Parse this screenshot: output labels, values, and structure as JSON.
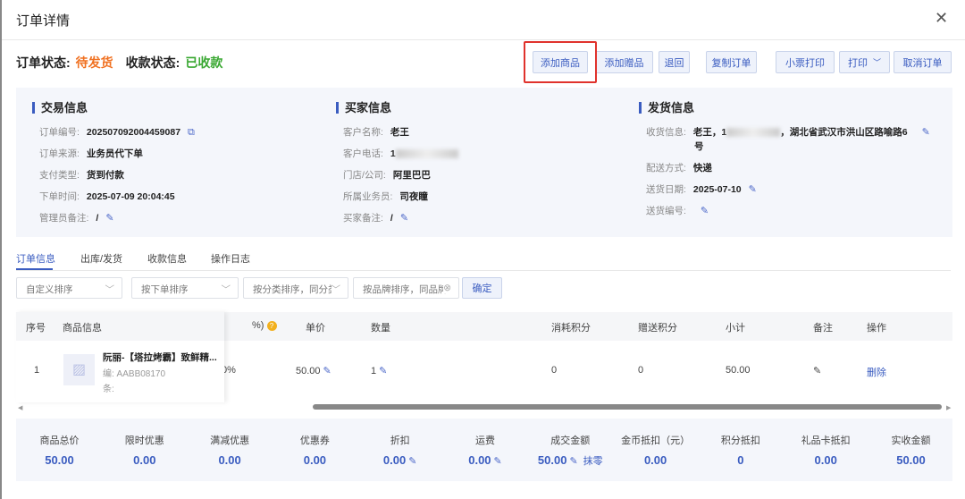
{
  "dialog": {
    "title": "订单详情"
  },
  "status": {
    "order_label": "订单状态:",
    "order_value": "待发货",
    "pay_label": "收款状态:",
    "pay_value": "已收款"
  },
  "actions": [
    "添加商品",
    "添加赠品",
    "退回",
    "复制订单",
    "小票打印",
    "打印",
    "取消订单"
  ],
  "trade": {
    "title": "交易信息",
    "rows": [
      {
        "k": "订单编号:",
        "v": "202507092004459087"
      },
      {
        "k": "订单来源:",
        "v": "业务员代下单"
      },
      {
        "k": "支付类型:",
        "v": "货到付款"
      },
      {
        "k": "下单时间:",
        "v": "2025-07-09 20:04:45"
      },
      {
        "k": "管理员备注:",
        "v": "/"
      }
    ]
  },
  "buyer": {
    "title": "买家信息",
    "rows": [
      {
        "k": "客户名称:",
        "v": "老王"
      },
      {
        "k": "客户电话:",
        "v": "1"
      },
      {
        "k": "门店/公司:",
        "v": "阿里巴巴"
      },
      {
        "k": "所属业务员:",
        "v": "司夜瞳"
      },
      {
        "k": "买家备注:",
        "v": "/"
      }
    ]
  },
  "ship": {
    "title": "发货信息",
    "rows": [
      {
        "k": "收货信息:",
        "v": "老王，1",
        "v2": "，湖北省武汉市洪山区路喻路6",
        "v3": "号"
      },
      {
        "k": "配送方式:",
        "v": "快递"
      },
      {
        "k": "送货日期:",
        "v": "2025-07-10"
      },
      {
        "k": "送货编号:",
        "v": ""
      }
    ]
  },
  "tabs": [
    "订单信息",
    "出库/发货",
    "收款信息",
    "操作日志"
  ],
  "filters": [
    "自定义排序",
    "按下单排序",
    "按分类排序，同分类",
    "按品牌排序，同品牌"
  ],
  "confirm": "确定",
  "table": {
    "headers": [
      "序号",
      "商品信息",
      "%)",
      "单价",
      "数量",
      "消耗积分",
      "赠送积分",
      "小计",
      "备注",
      "操作"
    ],
    "row": {
      "index": "1",
      "name": "阮丽-【塔拉烤霸】致鲜精...",
      "code": "编: AABB08170",
      "bar": "条:",
      "discount": "0%",
      "price": "50.00",
      "qty": "1",
      "used_points": "0",
      "given_points": "0",
      "subtotal": "50.00",
      "action": "删除"
    }
  },
  "summary": [
    {
      "k": "商品总价",
      "v": "50.00"
    },
    {
      "k": "限时优惠",
      "v": "0.00"
    },
    {
      "k": "满减优惠",
      "v": "0.00"
    },
    {
      "k": "优惠券",
      "v": "0.00"
    },
    {
      "k": "折扣",
      "v": "0.00"
    },
    {
      "k": "运费",
      "v": "0.00"
    },
    {
      "k": "成交金额",
      "v": "50.00",
      "extra": "抹零"
    },
    {
      "k": "金币抵扣（元）",
      "v": "0.00"
    },
    {
      "k": "积分抵扣",
      "v": "0"
    },
    {
      "k": "礼品卡抵扣",
      "v": "0.00"
    },
    {
      "k": "实收金额",
      "v": "50.00"
    }
  ]
}
